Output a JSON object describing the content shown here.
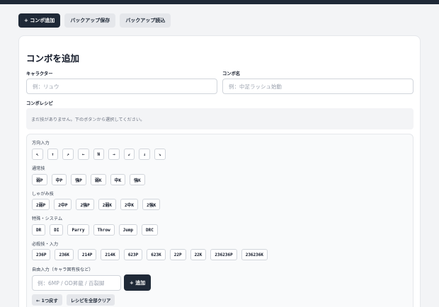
{
  "toolbar": {
    "add_combo": "+ コンボ追加",
    "backup_save": "バックアップ保存",
    "backup_load": "バックアップ読込"
  },
  "form": {
    "title": "コンボを追加",
    "character_label": "キャラクター",
    "character_placeholder": "例：リュウ",
    "combo_name_label": "コンボ名",
    "combo_name_placeholder": "例：中足ラッシュ始動",
    "recipe_label": "コンボレシピ",
    "recipe_empty": "まだ技がありません。下のボタンから選択してください。"
  },
  "palette": {
    "direction_label": "方向入力",
    "directions": [
      "↖",
      "↑",
      "↗",
      "←",
      "N",
      "→",
      "↙",
      "↓",
      "↘"
    ],
    "normals_label": "通常技",
    "normals": [
      "弱P",
      "中P",
      "強P",
      "弱K",
      "中K",
      "強K"
    ],
    "crouch_label": "しゃがみ技",
    "crouch": [
      "2弱P",
      "2中P",
      "2強P",
      "2弱K",
      "2中K",
      "2強K"
    ],
    "system_label": "特殊・システム",
    "system": [
      "DR",
      "DI",
      "Parry",
      "Throw",
      "Jump",
      "DRC"
    ],
    "special_label": "必殺技・入力",
    "special": [
      "236P",
      "236K",
      "214P",
      "214K",
      "623P",
      "623K",
      "22P",
      "22K",
      "236236P",
      "236236K"
    ],
    "free_label": "自由入力（キャラ固有技など）",
    "free_placeholder": "例：6MP / OD昇龍 / 百裂脚",
    "free_add": "+ 追加",
    "undo": "← 1つ戻す",
    "clear": "レシピを全部クリア"
  }
}
